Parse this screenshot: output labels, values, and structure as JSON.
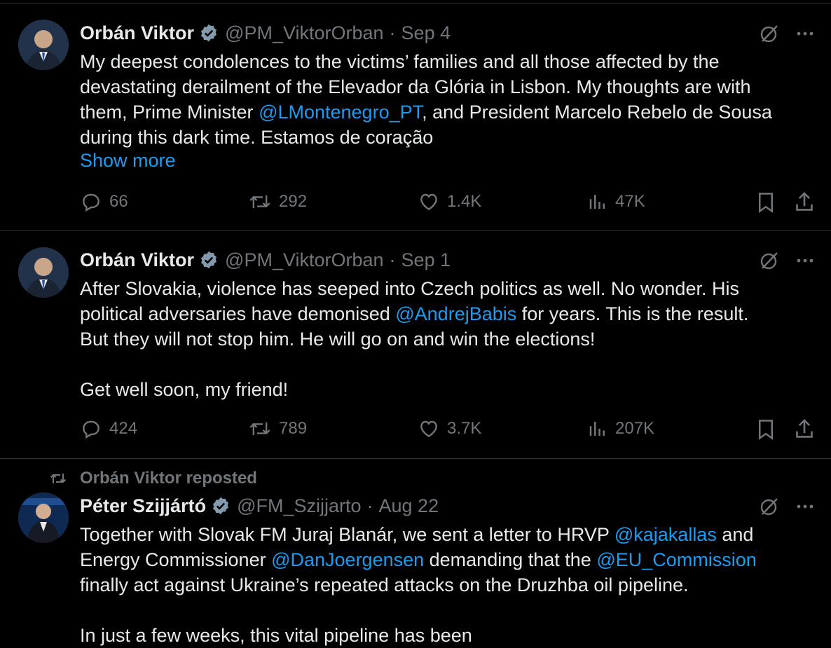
{
  "colors": {
    "background": "#000000",
    "text": "#e7e9ea",
    "muted": "#71767b",
    "link": "#1d9bf0",
    "divider": "#2f3336",
    "verified": "#829aab"
  },
  "tweets": [
    {
      "name": "Orbán Viktor",
      "handle": "@PM_ViktorOrban",
      "date": "Sep 4",
      "text_parts": [
        "My deepest condolences to the victims’ families and all those affected by the\ndevastating derailment of the Elevador da Glória in Lisbon. My thoughts are with\nthem, Prime Minister ",
        "@LMontenegro_PT",
        ", and President Marcelo Rebelo de Sousa\nduring this dark time. Estamos de coração"
      ],
      "show_more": "Show more",
      "replies": "66",
      "reposts": "292",
      "likes": "1.4K",
      "views": "47K"
    },
    {
      "name": "Orbán Viktor",
      "handle": "@PM_ViktorOrban",
      "date": "Sep 1",
      "text_parts": [
        "After Slovakia, violence has seeped into Czech politics as well. No wonder. His\npolitical adversaries have demonised ",
        "@AndrejBabis",
        " for years. This is the result.\nBut they will not stop him. He will go on and win the elections!\n\nGet well soon, my friend!"
      ],
      "replies": "424",
      "reposts": "789",
      "likes": "3.7K",
      "views": "207K"
    },
    {
      "reposted_by": "Orbán Viktor reposted",
      "name": "Péter Szijjártó",
      "handle": "@FM_Szijjarto",
      "date": "Aug 22",
      "text_parts": [
        "Together with Slovak FM Juraj Blanár, we sent a letter to HRVP ",
        "@kajakallas",
        " and\nEnergy Commissioner ",
        "@DanJoergensen",
        " demanding that the ",
        "@EU_Commission",
        "\nfinally act against Ukraine’s repeated attacks on the Druzhba oil pipeline.\n\nIn just a few weeks, this vital pipeline has been"
      ]
    }
  ],
  "icons": [
    "verified-badge-icon",
    "grok-icon",
    "more-icon",
    "reply-icon",
    "repost-icon",
    "like-icon",
    "views-icon",
    "bookmark-icon",
    "share-icon"
  ]
}
